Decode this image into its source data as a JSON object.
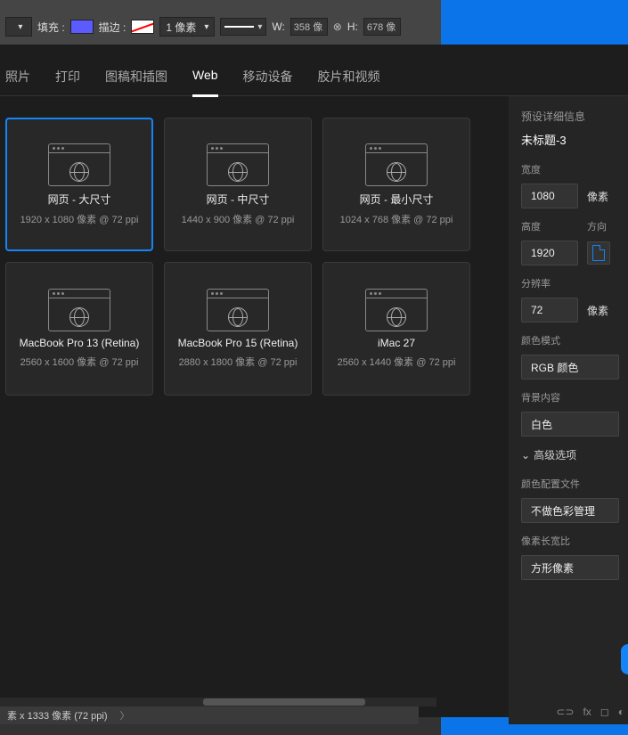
{
  "options_bar": {
    "fill_label": "填充 :",
    "stroke_label": "描边 :",
    "px_value": "1 像素",
    "w_label": "W:",
    "w_value": "358 像",
    "h_label": "H:",
    "h_value": "678 像"
  },
  "tabs": [
    "照片",
    "打印",
    "图稿和插图",
    "Web",
    "移动设备",
    "胶片和视频"
  ],
  "active_tab": 3,
  "presets": [
    {
      "name": "网页 - 大尺寸",
      "detail": "1920 x 1080 像素 @ 72 ppi",
      "selected": true
    },
    {
      "name": "网页 - 中尺寸",
      "detail": "1440 x 900 像素 @ 72 ppi",
      "selected": false
    },
    {
      "name": "网页 - 最小尺寸",
      "detail": "1024 x 768 像素 @ 72 ppi",
      "selected": false
    },
    {
      "name": "MacBook Pro 13 (Retina)",
      "detail": "2560 x 1600 像素 @ 72 ppi",
      "selected": false
    },
    {
      "name": "MacBook Pro 15 (Retina)",
      "detail": "2880 x 1800 像素 @ 72 ppi",
      "selected": false
    },
    {
      "name": "iMac 27",
      "detail": "2560 x 1440 像素 @ 72 ppi",
      "selected": false
    }
  ],
  "details": {
    "title": "预设详细信息",
    "doc_name": "未标题-3",
    "width_label": "宽度",
    "width_value": "1080",
    "unit": "像素",
    "height_label": "高度",
    "height_value": "1920",
    "orientation_label": "方向",
    "resolution_label": "分辨率",
    "resolution_value": "72",
    "resolution_unit": "像素",
    "color_mode_label": "颜色模式",
    "color_mode_value": "RGB 颜色",
    "background_label": "背景内容",
    "background_value": "白色",
    "advanced_label": "高级选项",
    "color_profile_label": "颜色配置文件",
    "color_profile_value": "不做色彩管理",
    "pixel_ratio_label": "像素长宽比",
    "pixel_ratio_value": "方形像素"
  },
  "status": "素 x 1333 像素 (72 ppi)"
}
